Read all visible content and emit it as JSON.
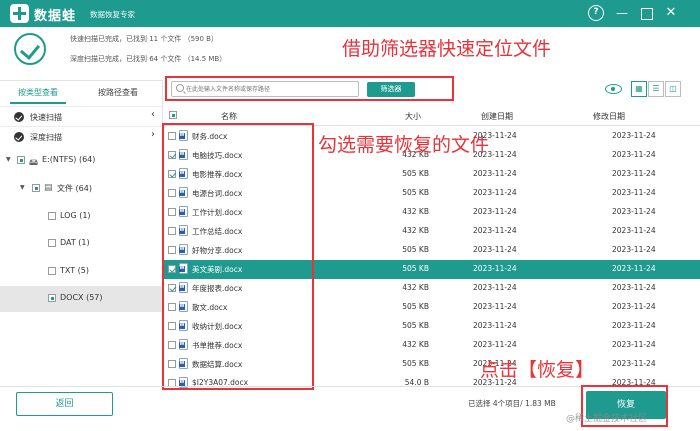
{
  "titlebar": {
    "app_name": "数据蛙",
    "subtitle": "数据恢复专家",
    "help": "?",
    "minimize": "—",
    "close": "✕"
  },
  "summary": {
    "quick_scan": "快速扫描已完成，已找到 11 个文件 （590 B）",
    "deep_scan": "深度扫描已完成，已找到 64 个文件 （14.5 MB）"
  },
  "annotations": {
    "filter_tip": "借助筛选器快速定位文件",
    "select_tip": "勾选需要恢复的文件",
    "restore_tip": "点击【恢复】"
  },
  "sidebar": {
    "tabs": [
      "按类型查看",
      "按路径查看"
    ],
    "modes": [
      {
        "label": "快速扫描",
        "chevron": "‹"
      },
      {
        "label": "深度扫描",
        "chevron": "›"
      }
    ],
    "tree": [
      {
        "label": "E:(NTFS) (64)",
        "twisty": "▼",
        "icon": "🖴"
      },
      {
        "label": "文件 (64)",
        "twisty": "▼",
        "icon": "▤"
      },
      {
        "label": "LOG (1)"
      },
      {
        "label": "DAT (1)"
      },
      {
        "label": "TXT (5)"
      },
      {
        "label": "DOCX (57)"
      }
    ]
  },
  "toolbar": {
    "search_placeholder": "在此处输入文件名称或保存路径",
    "filter_label": "筛选器",
    "view_grid": "▦",
    "view_list": "☰",
    "view_detail": "◫"
  },
  "table": {
    "columns": [
      "名称",
      "大小",
      "创建日期",
      "修改日期"
    ],
    "rows": [
      {
        "name": "财务.docx",
        "size": "",
        "created": "2023-11-24",
        "modified": "2023-11-24",
        "checked": false,
        "selected": false
      },
      {
        "name": "电脑技巧.docx",
        "size": "432 KB",
        "created": "2023-11-24",
        "modified": "2023-11-24",
        "checked": true,
        "selected": false
      },
      {
        "name": "电影推荐.docx",
        "size": "505 KB",
        "created": "2023-11-24",
        "modified": "2023-11-24",
        "checked": true,
        "selected": false
      },
      {
        "name": "电源台词.docx",
        "size": "505 KB",
        "created": "2023-11-24",
        "modified": "2023-11-24",
        "checked": false,
        "selected": false
      },
      {
        "name": "工作计划.docx",
        "size": "432 KB",
        "created": "2023-11-24",
        "modified": "2023-11-24",
        "checked": false,
        "selected": false
      },
      {
        "name": "工作总结.docx",
        "size": "432 KB",
        "created": "2023-11-24",
        "modified": "2023-11-24",
        "checked": false,
        "selected": false
      },
      {
        "name": "好物分享.docx",
        "size": "505 KB",
        "created": "2023-11-24",
        "modified": "2023-11-24",
        "checked": false,
        "selected": false
      },
      {
        "name": "美文美剧.docx",
        "size": "505 KB",
        "created": "2023-11-24",
        "modified": "2023-11-24",
        "checked": true,
        "selected": true
      },
      {
        "name": "年度报表.docx",
        "size": "432 KB",
        "created": "2023-11-24",
        "modified": "2023-11-24",
        "checked": true,
        "selected": false
      },
      {
        "name": "散文.docx",
        "size": "505 KB",
        "created": "2023-11-24",
        "modified": "2023-11-24",
        "checked": false,
        "selected": false
      },
      {
        "name": "收纳计划.docx",
        "size": "505 KB",
        "created": "2023-11-24",
        "modified": "2023-11-24",
        "checked": false,
        "selected": false
      },
      {
        "name": "书单推荐.docx",
        "size": "432 KB",
        "created": "2023-11-24",
        "modified": "2023-11-24",
        "checked": false,
        "selected": false
      },
      {
        "name": "数据结算.docx",
        "size": "505 KB",
        "created": "2023-11-24",
        "modified": "2023-11-24",
        "checked": false,
        "selected": false
      },
      {
        "name": "$I2Y3A07.docx",
        "size": "54.0 B",
        "created": "2023-11-24",
        "modified": "2023-11-24",
        "checked": false,
        "selected": false
      }
    ]
  },
  "footer": {
    "back_label": "返回",
    "status": "已选择 4个项目/ 1.83 MB",
    "restore_label": "恢复",
    "watermark": "@稀土掘金技术社区"
  },
  "colors": {
    "accent": "#1e9a8f",
    "annotation": "#e8333a"
  }
}
